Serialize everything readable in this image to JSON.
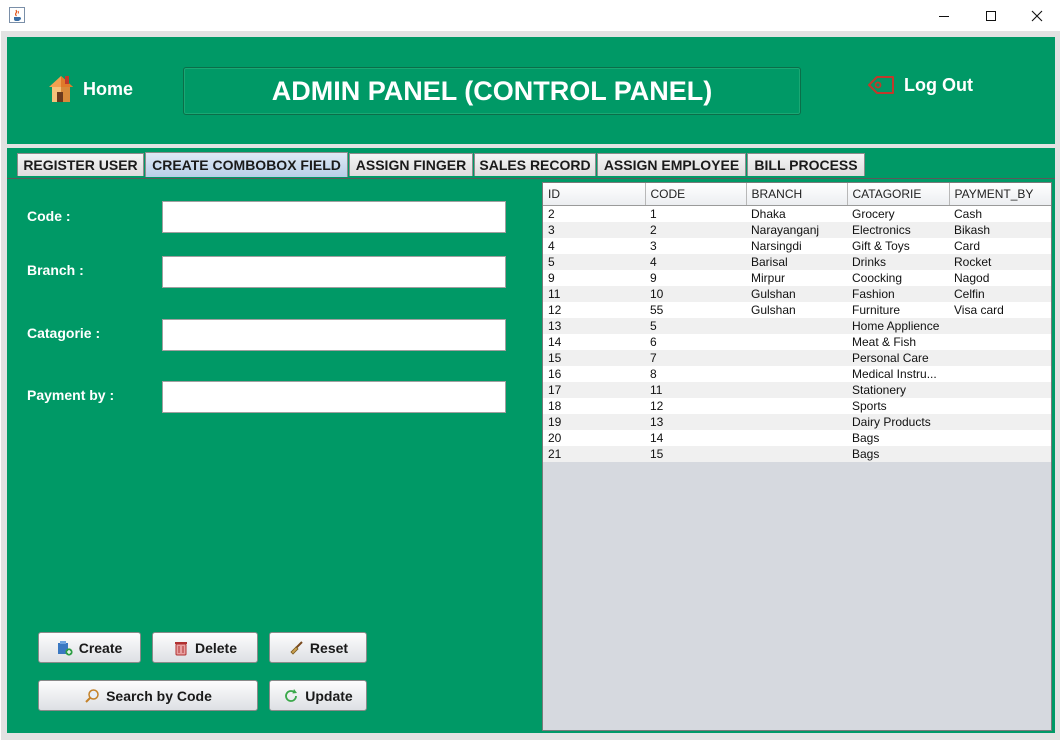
{
  "window": {
    "minimize_glyph": "—",
    "maximize_glyph": "☐",
    "close_glyph": "✕",
    "app_icon": "java-icon"
  },
  "header": {
    "home_label": "Home",
    "home_icon": "house-icon",
    "title": "ADMIN PANEL (CONTROL PANEL)",
    "logout_label": "Log Out",
    "logout_icon": "tag-icon",
    "bg_color": "#009966"
  },
  "tabs": [
    {
      "label": "REGISTER USER",
      "active": false
    },
    {
      "label": "CREATE COMBOBOX FIELD",
      "active": true
    },
    {
      "label": "ASSIGN FINGER",
      "active": false
    },
    {
      "label": "SALES RECORD",
      "active": false
    },
    {
      "label": "ASSIGN EMPLOYEE",
      "active": false
    },
    {
      "label": "BILL PROCESS",
      "active": false
    }
  ],
  "form": {
    "code_label": "Code :",
    "code_value": "",
    "branch_label": "Branch :",
    "branch_value": "",
    "catagorie_label": "Catagorie :",
    "catagorie_value": "",
    "payment_label": "Payment by :",
    "payment_value": ""
  },
  "buttons": {
    "create": "Create",
    "delete": "Delete",
    "reset": "Reset",
    "search": "Search by Code",
    "update": "Update"
  },
  "table": {
    "columns": [
      "ID",
      "CODE",
      "BRANCH",
      "CATAGORIE",
      "PAYMENT_BY"
    ],
    "rows": [
      [
        "2",
        "1",
        "Dhaka",
        "Grocery",
        "Cash"
      ],
      [
        "3",
        "2",
        "Narayanganj",
        "Electronics",
        "Bikash"
      ],
      [
        "4",
        "3",
        "Narsingdi",
        "Gift & Toys",
        "Card"
      ],
      [
        "5",
        "4",
        "Barisal",
        "Drinks",
        "Rocket"
      ],
      [
        "9",
        "9",
        "Mirpur",
        "Coocking",
        "Nagod"
      ],
      [
        "11",
        "10",
        "Gulshan",
        "Fashion",
        "Celfin"
      ],
      [
        "12",
        "55",
        "Gulshan",
        "Furniture",
        "Visa card"
      ],
      [
        "13",
        "5",
        "",
        "Home Applience",
        ""
      ],
      [
        "14",
        "6",
        "",
        "Meat & Fish",
        ""
      ],
      [
        "15",
        "7",
        "",
        "Personal Care",
        ""
      ],
      [
        "16",
        "8",
        "",
        "Medical Instru...",
        ""
      ],
      [
        "17",
        "11",
        "",
        "Stationery",
        ""
      ],
      [
        "18",
        "12",
        "",
        "Sports",
        ""
      ],
      [
        "19",
        "13",
        "",
        "Dairy Products",
        ""
      ],
      [
        "20",
        "14",
        "",
        "Bags",
        ""
      ],
      [
        "21",
        "15",
        "",
        "Bags",
        ""
      ]
    ]
  }
}
